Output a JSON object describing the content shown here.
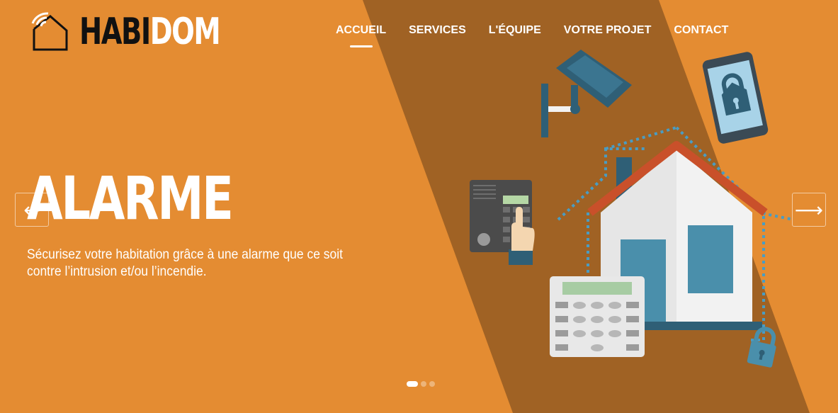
{
  "brand": {
    "logo_part1": "HABI",
    "logo_part2": "DOM"
  },
  "nav": {
    "items": [
      {
        "label": "ACCUEIL",
        "active": true
      },
      {
        "label": "SERVICES",
        "active": false
      },
      {
        "label": "L'ÉQUIPE",
        "active": false
      },
      {
        "label": "VOTRE PROJET",
        "active": false
      },
      {
        "label": "CONTACT",
        "active": false
      }
    ]
  },
  "slide": {
    "title": "ALARME",
    "description": "Sécurisez votre habitation grâce à une alarme que ce soit contre l’intrusion et/ou l’incendie."
  },
  "carousel": {
    "prev_arrow": "←",
    "next_arrow": "⟶",
    "slide_count": 3,
    "active_index": 0
  },
  "colors": {
    "background": "#e48c32",
    "band": "#a06224",
    "house_roof": "#c9502a",
    "house_wall": "#e8e8e8",
    "device_blue": "#4a8fab",
    "camera": "#2f5f76"
  },
  "icons": [
    "logo-house-icon",
    "security-camera-icon",
    "smartphone-lock-icon",
    "intercom-keypad-icon",
    "house-icon",
    "alarm-keypad-icon",
    "padlock-icon"
  ]
}
